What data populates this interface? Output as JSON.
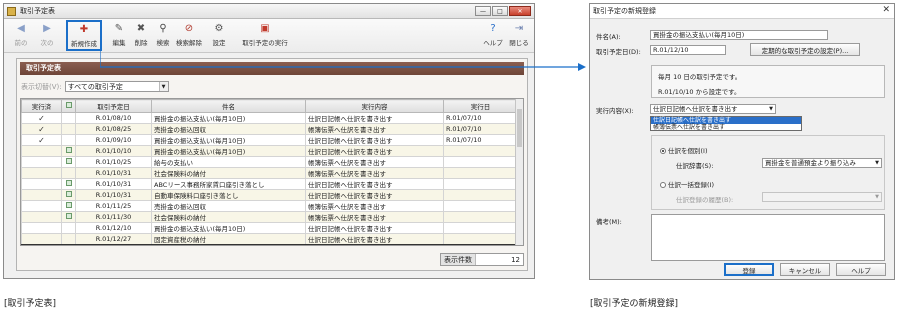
{
  "left_window": {
    "title": "取引予定表",
    "toolbar": [
      {
        "label": "前の",
        "icon": "back-arrow-icon"
      },
      {
        "label": "次の",
        "icon": "forward-arrow-icon"
      },
      {
        "label": "新規作成",
        "icon": "new-document-icon"
      },
      {
        "label": "編集",
        "icon": "edit-icon"
      },
      {
        "label": "削除",
        "icon": "delete-icon"
      },
      {
        "label": "検索",
        "icon": "search-icon"
      },
      {
        "label": "検索解除",
        "icon": "search-clear-icon"
      },
      {
        "label": "設定",
        "icon": "settings-icon"
      },
      {
        "label": "取引予定の実行",
        "icon": "execute-icon"
      },
      {
        "label": "ヘルプ",
        "icon": "help-icon"
      },
      {
        "label": "閉じる",
        "icon": "close-door-icon"
      }
    ],
    "panel_title": "取引予定表",
    "filter_label": "表示切替(V):",
    "filter_value": "すべての取引予定",
    "columns": [
      "実行済",
      "",
      "取引予定日",
      "件名",
      "実行内容",
      "実行日"
    ],
    "rows": [
      {
        "done": true,
        "mark": false,
        "date": "R.01/08/10",
        "subject": "買掛金の振込支払い(毎月10日)",
        "action": "仕訳日記帳へ仕訳を書き出す",
        "exec_date": "R.01/07/10"
      },
      {
        "done": true,
        "mark": false,
        "date": "R.01/08/25",
        "subject": "売掛金の振込回収",
        "action": "帳簿伝票へ仕訳を書き出す",
        "exec_date": "R.01/07/10"
      },
      {
        "done": true,
        "mark": false,
        "date": "R.01/09/10",
        "subject": "買掛金の振込支払い(毎月10日)",
        "action": "仕訳日記帳へ仕訳を書き出す",
        "exec_date": "R.01/07/10"
      },
      {
        "done": false,
        "mark": true,
        "date": "R.01/10/10",
        "subject": "買掛金の振込支払い(毎月10日)",
        "action": "仕訳日記帳へ仕訳を書き出す",
        "exec_date": ""
      },
      {
        "done": false,
        "mark": true,
        "date": "R.01/10/25",
        "subject": "給与の支払い",
        "action": "帳簿伝票へ仕訳を書き出す",
        "exec_date": ""
      },
      {
        "done": false,
        "mark": false,
        "date": "R.01/10/31",
        "subject": "社会保険料の納付",
        "action": "帳簿伝票へ仕訳を書き出す",
        "exec_date": ""
      },
      {
        "done": false,
        "mark": true,
        "date": "R.01/10/31",
        "subject": "ABCリース事務所家賃口座引き落とし",
        "action": "仕訳日記帳へ仕訳を書き出す",
        "exec_date": ""
      },
      {
        "done": false,
        "mark": true,
        "date": "R.01/10/31",
        "subject": "自動車保険料口座引き落とし",
        "action": "仕訳日記帳へ仕訳を書き出す",
        "exec_date": ""
      },
      {
        "done": false,
        "mark": true,
        "date": "R.01/11/25",
        "subject": "売掛金の振込回収",
        "action": "帳簿伝票へ仕訳を書き出す",
        "exec_date": ""
      },
      {
        "done": false,
        "mark": true,
        "date": "R.01/11/30",
        "subject": "社会保険料の納付",
        "action": "帳簿伝票へ仕訳を書き出す",
        "exec_date": ""
      },
      {
        "done": false,
        "mark": false,
        "date": "R.01/12/10",
        "subject": "買掛金の振込支払い(毎月10日)",
        "action": "仕訳日記帳へ仕訳を書き出す",
        "exec_date": ""
      },
      {
        "done": false,
        "mark": false,
        "date": "R.01/12/27",
        "subject": "固定資産税の納付",
        "action": "仕訳日記帳へ仕訳を書き出す",
        "exec_date": ""
      }
    ],
    "count_label": "表示件数",
    "count_value": "12",
    "caption": "[取引予定表]"
  },
  "dialog": {
    "title": "取引予定の新規登録",
    "close_glyph": "✕",
    "subject_label": "件名(A):",
    "subject_value": "買掛金の振込支払い(毎月10日)",
    "date_label": "取引予定日(D):",
    "date_value": "R.01/12/10",
    "periodic_button": "定期的な取引予定の設定(P)...",
    "info_line1": "毎月 10 日の取引予定です。",
    "info_line2": "R.01/10/10 から設定です。",
    "action_label": "実行内容(X):",
    "action_value": "仕訳日記帳へ仕訳を書き出す",
    "dropdown_options": [
      "仕訳日記帳へ仕訳を書き出す",
      "帳簿伝票へ仕訳を書き出す"
    ],
    "radio_single_label": "仕訳を個別(I)",
    "journal_label": "仕訳辞書(S):",
    "journal_value": "買掛金を普通預金より振り込み",
    "radio_batch_label": "仕訳一括登録(I)",
    "batch_label": "仕訳登録の履歴(B):",
    "memo_label": "備考(M):",
    "register_button": "登録",
    "cancel_button": "キャンセル",
    "help_button": "ヘルプ",
    "caption": "[取引予定の新規登録]"
  },
  "colors": {
    "accent": "#1b6fc9",
    "panel_header": "#7a4f41"
  }
}
